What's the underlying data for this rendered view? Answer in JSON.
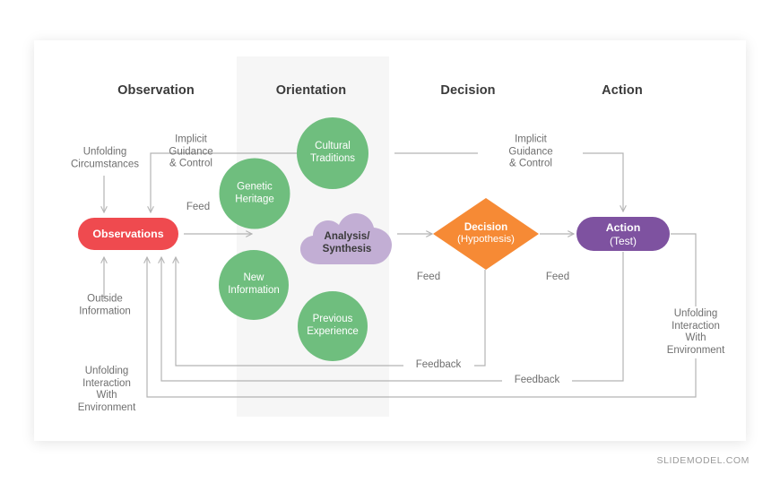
{
  "watermark": "SLIDEMODEL.COM",
  "colors": {
    "observations": "#ef4a4f",
    "orientation_circle": "#6fbe7e",
    "analysis_cloud": "#c2aed4",
    "decision": "#f68a35",
    "action": "#7e52a0",
    "wire": "#b4b4b4",
    "panel": "#f6f6f6",
    "title_text": "#3a3a3a",
    "label_text": "#6f6f6f"
  },
  "columns": [
    {
      "label": "Observation"
    },
    {
      "label": "Orientation"
    },
    {
      "label": "Decision"
    },
    {
      "label": "Action"
    }
  ],
  "nodes": {
    "observations": {
      "label": "Observations"
    },
    "genetic_heritage": {
      "label": "Genetic\nHeritage"
    },
    "cultural_traditions": {
      "label": "Cultural\nTraditions"
    },
    "new_information": {
      "label": "New\nInformation"
    },
    "previous_experience": {
      "label": "Previous\nExperience"
    },
    "analysis_synthesis": {
      "line1": "Analysis/",
      "line2": "Synthesis"
    },
    "decision": {
      "line1": "Decision",
      "line2": "(Hypothesis)"
    },
    "action": {
      "line1": "Action",
      "line2": "(Test)"
    }
  },
  "wire_labels": {
    "unfolding_circumstances": "Unfolding\nCircumstances",
    "implicit_guidance_left": "Implicit\nGuidance\n& Control",
    "implicit_guidance_right": "Implicit\nGuidance\n& Control",
    "feed_observation": "Feed",
    "feed_decision": "Feed",
    "feed_action": "Feed",
    "outside_information": "Outside\nInformation",
    "unfolding_interaction_left": "Unfolding\nInteraction\nWith\nEnvironment",
    "unfolding_interaction_right": "Unfolding\nInteraction\nWith\nEnvironment",
    "feedback_upper": "Feedback",
    "feedback_lower": "Feedback"
  }
}
